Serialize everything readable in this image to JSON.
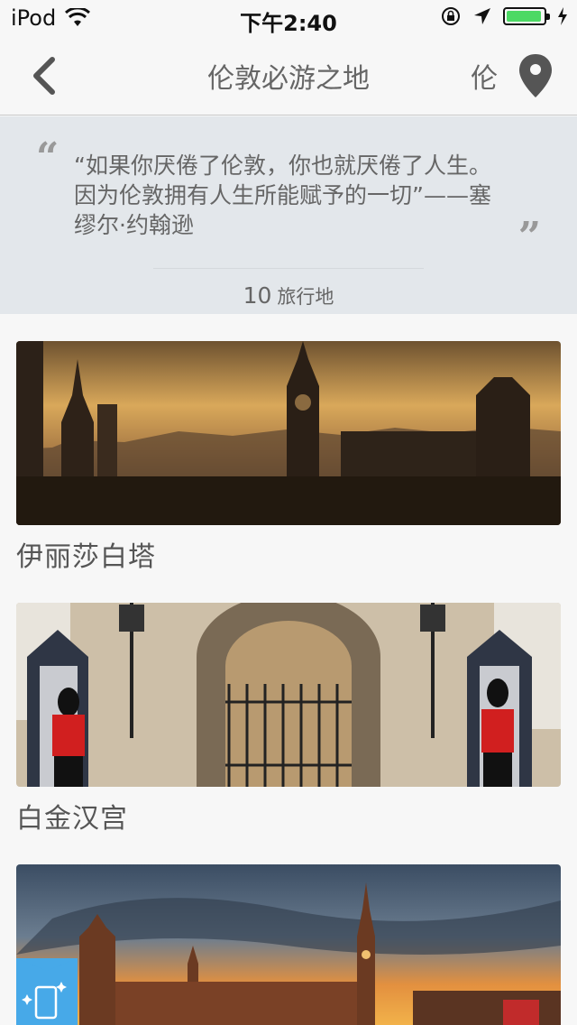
{
  "status_bar": {
    "carrier": "iPod",
    "time": "下午2:40",
    "battery_level": 0.95,
    "battery_color": "#4cd964"
  },
  "nav": {
    "back_icon": "chevron-left-icon",
    "title": "伦敦必游之地",
    "city": "伦",
    "location_icon": "map-pin-icon"
  },
  "quote": {
    "text": "“如果你厌倦了伦敦，你也就厌倦了人生。因为伦敦拥有人生所能赋予的一切”——塞缪尔·约翰逊",
    "count": "10",
    "count_unit": "旅行地"
  },
  "places": [
    {
      "title": "伊丽莎白塔",
      "image": "london-skyline-sunset"
    },
    {
      "title": "白金汉宫",
      "image": "buckingham-palace-guards"
    },
    {
      "title": "",
      "image": "houses-of-parliament-sunset"
    }
  ],
  "colors": {
    "accent": "#47a9e8",
    "panel": "#e3e7eb"
  }
}
